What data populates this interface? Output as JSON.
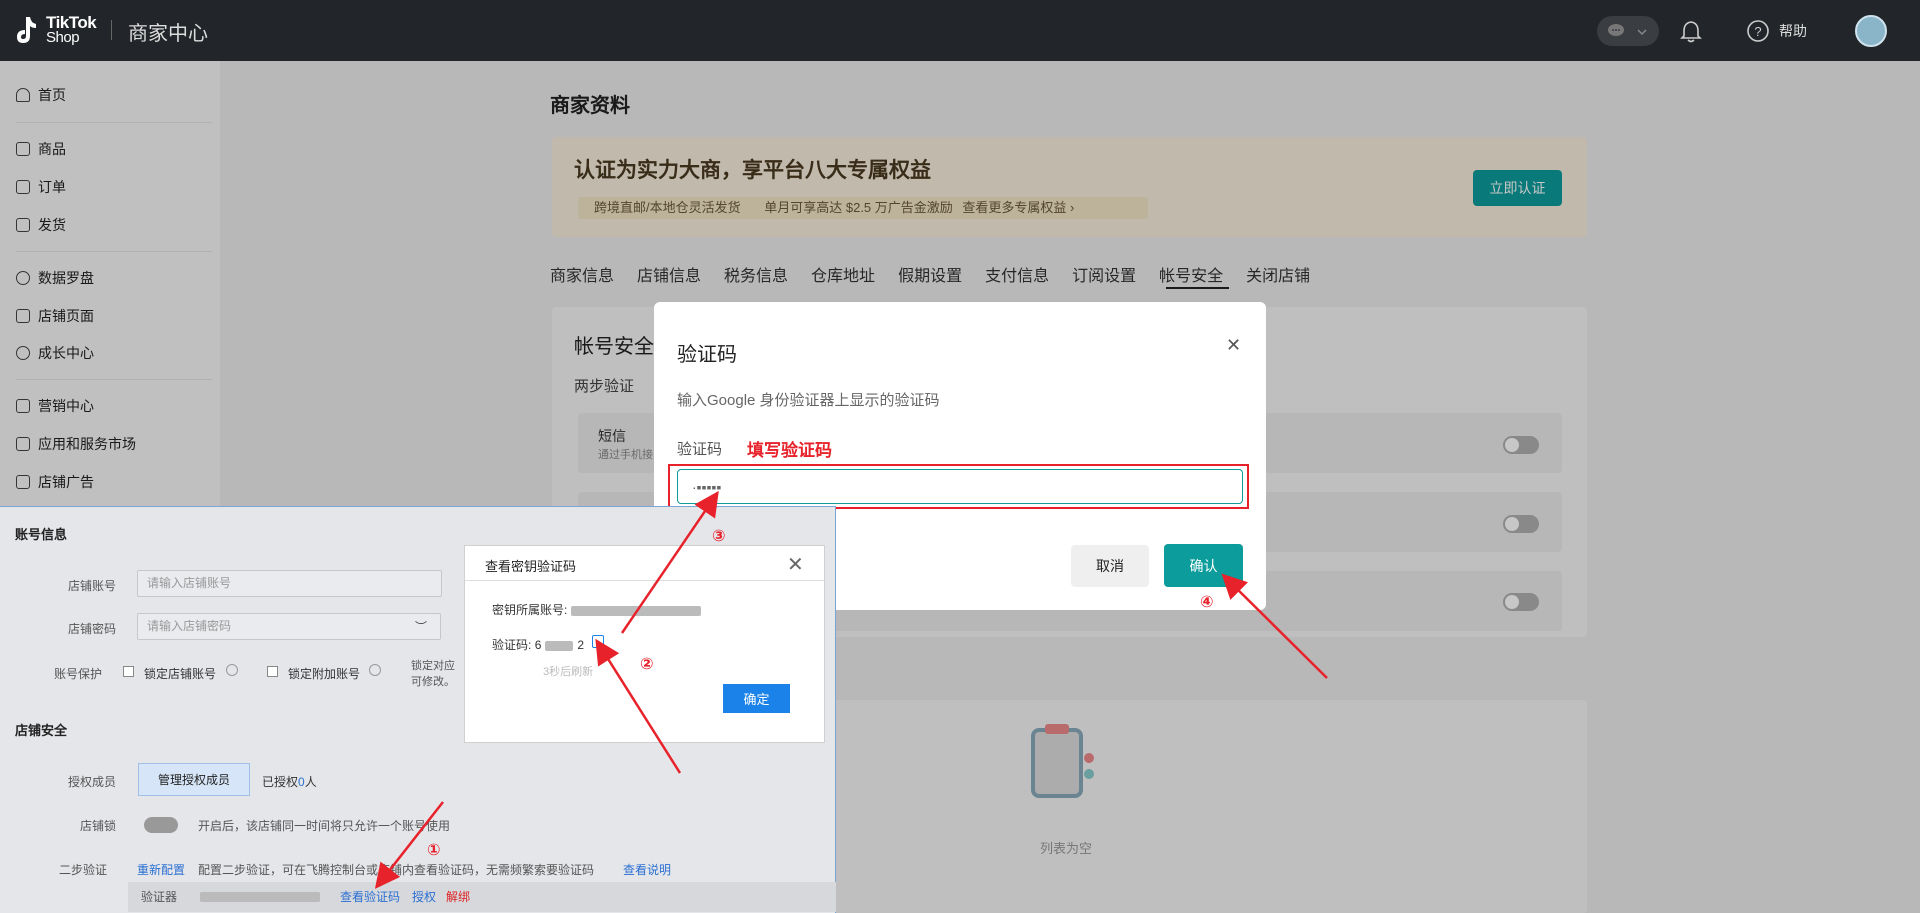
{
  "topbar": {
    "logo_line1": "TikTok",
    "logo_line2": "Shop",
    "title": "商家中心",
    "help": "帮助",
    "icons": [
      "chat-icon",
      "bell-icon",
      "help-icon",
      "avatar"
    ]
  },
  "sidebar": {
    "items": [
      {
        "label": "首页",
        "icon": "home-icon"
      },
      {
        "label": "商品",
        "icon": "box-icon"
      },
      {
        "label": "订单",
        "icon": "clipboard-icon"
      },
      {
        "label": "发货",
        "icon": "truck-icon"
      },
      {
        "label": "数据罗盘",
        "icon": "compass-icon"
      },
      {
        "label": "店铺页面",
        "icon": "store-icon"
      },
      {
        "label": "成长中心",
        "icon": "medal-icon"
      },
      {
        "label": "营销中心",
        "icon": "megaphone-icon"
      },
      {
        "label": "应用和服务市场",
        "icon": "apps-icon"
      },
      {
        "label": "店铺广告",
        "icon": "ad-icon"
      }
    ]
  },
  "main": {
    "page_title": "商家资料",
    "banner": {
      "title": "认证为实力大商，享平台八大专属权益",
      "sub1": "跨境直邮/本地仓灵活发货",
      "sub2": "单月可享高达 $2.5 万广告金激励",
      "more": "查看更多专属权益",
      "button": "立即认证"
    },
    "tabs": [
      "商家信息",
      "店铺信息",
      "税务信息",
      "仓库地址",
      "假期设置",
      "支付信息",
      "订阅设置",
      "帐号安全",
      "关闭店铺"
    ],
    "active_tab": "帐号安全",
    "card_title": "帐号安全",
    "two_step": "两步验证",
    "sms_title": "短信",
    "sms_desc": "通过手机接收",
    "empty": "列表为空"
  },
  "modal": {
    "title": "验证码",
    "desc": "输入Google 身份验证器上显示的验证码",
    "label": "验证码",
    "note": "填写验证码",
    "input_value": "·▪▪▪▪▪",
    "cancel": "取消",
    "confirm": "确认"
  },
  "panel": {
    "account_info": "账号信息",
    "store_account_label": "店铺账号",
    "store_account_placeholder": "请输入店铺账号",
    "store_password_label": "店铺密码",
    "store_password_placeholder": "请输入店铺密码",
    "protect_label": "账号保护",
    "lock_store": "锁定店铺账号",
    "lock_extra": "锁定附加账号",
    "lock_note1": "锁定对应",
    "lock_note2": "可修改。",
    "store_security": "店铺安全",
    "auth_members_label": "授权成员",
    "manage_button": "管理授权成员",
    "authorized_prefix": "已授权",
    "authorized_count": "0",
    "authorized_suffix": "人",
    "store_lock_label": "店铺锁",
    "store_lock_desc": "开启后，该店铺同一时间将只允许一个账号使用",
    "twostep_label": "二步验证",
    "reconfig": "重新配置",
    "twostep_desc": "配置二步验证，可在飞腾控制台或店铺内查看验证码，无需频繁索要验证码",
    "view_desc": "查看说明",
    "authenticator_label": "验证器",
    "view_code": "查看验证码",
    "authorize": "授权",
    "unbind": "解绑"
  },
  "popup": {
    "title": "查看密钥验证码",
    "account_label": "密钥所属账号:",
    "code_label": "验证码:",
    "code_start": "6",
    "code_end": "2",
    "refresh": "3秒后刷新",
    "button": "确定"
  },
  "annotations": [
    "①",
    "②",
    "③",
    "④"
  ],
  "colors": {
    "teal": "#0d9c9c",
    "red": "#e8222b",
    "blue": "#1a82e8",
    "topbar": "#222529"
  }
}
